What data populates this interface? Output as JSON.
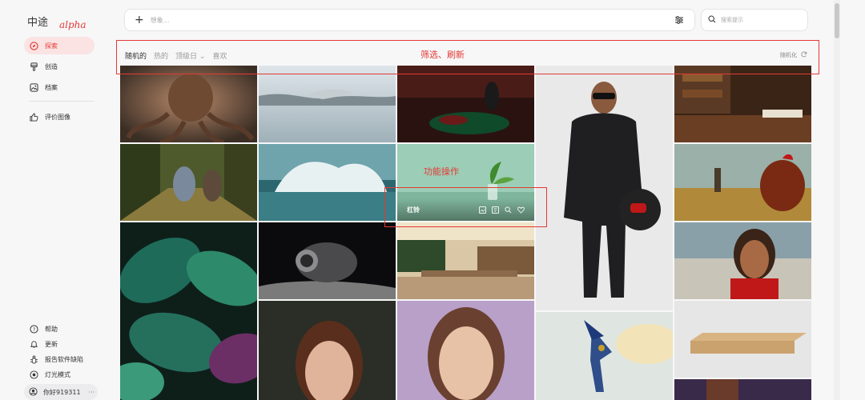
{
  "app": {
    "logo": "中途",
    "logo_tag": "alpha"
  },
  "sidebar": {
    "items": [
      {
        "label": "探索",
        "icon": "compass-icon",
        "active": true
      },
      {
        "label": "创造",
        "icon": "paintbrush-icon",
        "active": false
      },
      {
        "label": "档案",
        "icon": "image-archive-icon",
        "active": false
      },
      {
        "label": "评价图像",
        "icon": "thumbs-up-icon",
        "active": false
      }
    ],
    "bottom": [
      {
        "label": "帮助",
        "icon": "help-icon"
      },
      {
        "label": "更新",
        "icon": "bell-icon"
      },
      {
        "label": "报告软件缺陷",
        "icon": "bug-icon"
      },
      {
        "label": "灯光模式",
        "icon": "sun-icon"
      }
    ],
    "user": {
      "name": "你好919311",
      "more": "···"
    }
  },
  "search": {
    "placeholder": "想象...",
    "hint_placeholder": "搜索提示"
  },
  "filters": {
    "tabs": [
      "随机的",
      "热的",
      "顶级日 ⌄",
      "喜欢"
    ],
    "annotation": "筛选、刷新",
    "randomize_label": "随机化"
  },
  "gallery": {
    "hover_overlay": {
      "name": "杠铃",
      "annotation": "功能操作"
    },
    "colors": {
      "accent": "#e53935",
      "active_bg": "#fbe3e3"
    }
  }
}
